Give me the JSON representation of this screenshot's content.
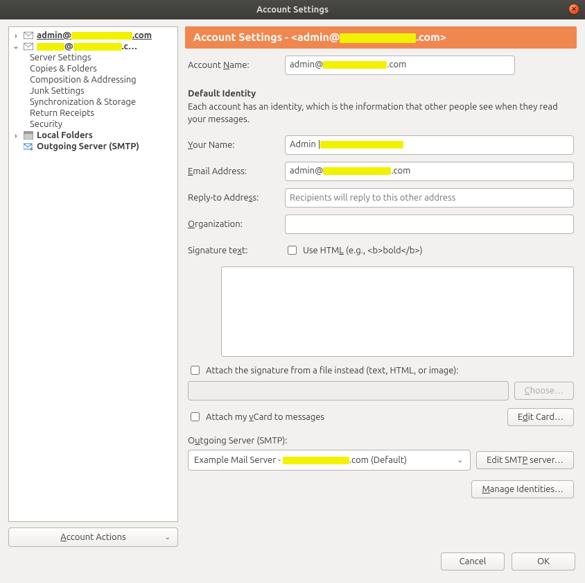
{
  "window": {
    "title": "Account Settings"
  },
  "sidebar": {
    "accounts": [
      {
        "prefix": "admin@",
        "suffix": ".com"
      },
      {
        "prefix": "@",
        "suffix": ".c…"
      }
    ],
    "items": [
      "Server Settings",
      "Copies & Folders",
      "Composition & Addressing",
      "Junk Settings",
      "Synchronization & Storage",
      "Return Receipts",
      "Security"
    ],
    "local_folders": "Local Folders",
    "outgoing": "Outgoing Server (SMTP)",
    "actions_label": "Account Actions"
  },
  "header": {
    "prefix": "Account Settings - <admin@",
    "suffix": ".com>"
  },
  "form": {
    "account_name_label": "Account Name:",
    "account_name_prefix": "admin@",
    "account_name_suffix": ".com",
    "identity_title": "Default Identity",
    "identity_desc": "Each account has an identity, which is the information that other people see when they read your messages.",
    "your_name_label": "Your Name:",
    "your_name_value": "Admin | ",
    "email_label": "Email Address:",
    "email_prefix": "admin@",
    "email_suffix": ".com",
    "reply_label": "Reply-to Address:",
    "reply_placeholder": "Recipients will reply to this other address",
    "org_label": "Organization:",
    "sig_label": "Signature text:",
    "use_html_label": "Use HTML (e.g., <b>bold</b>)",
    "attach_file_label": "Attach the signature from a file instead (text, HTML, or image):",
    "choose_label": "Choose…",
    "attach_vcard_label": "Attach my vCard to messages",
    "edit_card_label": "Edit Card…",
    "smtp_label": "Outgoing Server (SMTP):",
    "smtp_value_prefix": "Example Mail Server - ",
    "smtp_value_suffix": ".com (Default)",
    "edit_smtp_label": "Edit SMTP server…",
    "manage_label": "Manage Identities…"
  },
  "footer": {
    "cancel": "Cancel",
    "ok": "OK"
  }
}
